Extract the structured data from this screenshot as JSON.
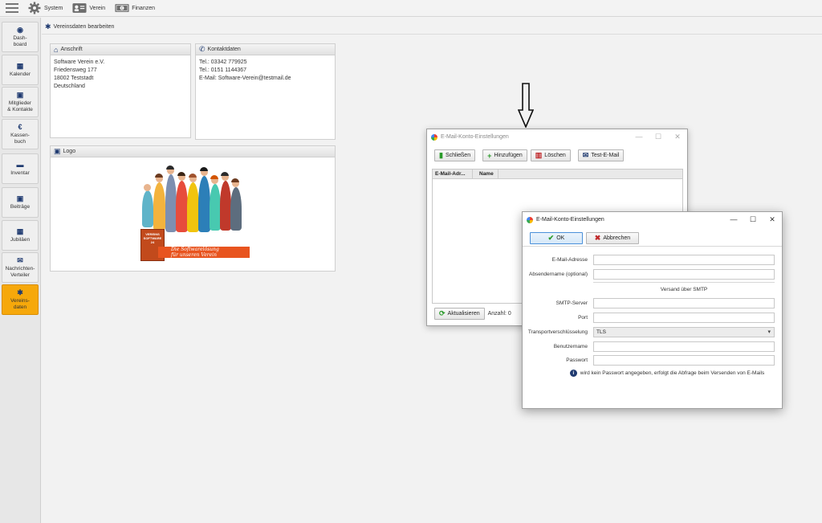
{
  "topbar": {
    "menus": [
      {
        "label": "System",
        "icon": "gear-icon"
      },
      {
        "label": "Verein",
        "icon": "contact-card-icon"
      },
      {
        "label": "Finanzen",
        "icon": "banknote-icon"
      }
    ]
  },
  "sidebar": {
    "items": [
      {
        "label": "Dash-\nboard",
        "icon": "dashboard-icon",
        "glyph": "◉"
      },
      {
        "label": "Kalender",
        "icon": "calendar-icon",
        "glyph": "▦"
      },
      {
        "label": "Mitglieder\n& Kontakte",
        "icon": "contacts-icon",
        "glyph": "▣"
      },
      {
        "label": "Kassen-\nbuch",
        "icon": "euro-icon",
        "glyph": "€"
      },
      {
        "label": "Inventar",
        "icon": "inventory-icon",
        "glyph": "▬"
      },
      {
        "label": "Beiträge",
        "icon": "money-icon",
        "glyph": "▣"
      },
      {
        "label": "Jubiläen",
        "icon": "calendar-grid-icon",
        "glyph": "▦"
      },
      {
        "label": "Nachrichten-\nVerteiler",
        "icon": "mail-icon",
        "glyph": "✉"
      },
      {
        "label": "Vereins-\ndaten",
        "icon": "gear-icon",
        "glyph": "✱"
      }
    ],
    "active_index": 8
  },
  "breadcrumb": {
    "label": "Vereinsdaten bearbeiten"
  },
  "anschrift": {
    "title": "Anschrift",
    "lines": [
      "Software Verein  e.V.",
      "Friedensweg 177",
      "18002 Teststadt",
      "Deutschland"
    ]
  },
  "kontakt": {
    "title": "Kontaktdaten",
    "lines": [
      "Tel.: 03342 779925",
      "Tel.: 0151 1144367",
      "E-Mail: Software-Verein@testmail.de"
    ]
  },
  "logo": {
    "title": "Logo",
    "box_text": "VEREINS SOFTWARE 24",
    "banner_line1": "Die Softwarelösung",
    "banner_line2": "für unseren Verein"
  },
  "window1": {
    "title": "E-Mail-Konto-Einstellungen",
    "buttons": {
      "close": "Schließen",
      "add": "Hinzufügen",
      "delete": "Löschen",
      "test": "Test-E-Mail"
    },
    "columns": [
      "E-Mail-Adr...",
      "Name"
    ],
    "refresh": "Aktualisieren",
    "count_label": "Anzahl: 0"
  },
  "window2": {
    "title": "E-Mail-Konto-Einstellungen",
    "ok": "OK",
    "cancel": "Abbrechen",
    "fields": {
      "email_label": "E-Mail-Adresse",
      "email_value": "",
      "sender_label": "Absendername (optional)",
      "sender_value": "",
      "section": "Versand über SMTP",
      "smtp_label": "SMTP-Server",
      "smtp_value": "",
      "port_label": "Port",
      "port_value": "",
      "transport_label": "Transportverschlüsselung",
      "transport_value": "TLS",
      "user_label": "Benutzername",
      "user_value": "",
      "pass_label": "Passwort",
      "pass_value": ""
    },
    "info": "wird kein Passwort angegeben, erfolgt die Abfrage beim Versenden von E-Mails"
  },
  "colors": {
    "accent": "#f6a80b",
    "nav_icon": "#1f3a70",
    "ok_green": "#2a9a2a",
    "cancel_red": "#c0282a"
  }
}
